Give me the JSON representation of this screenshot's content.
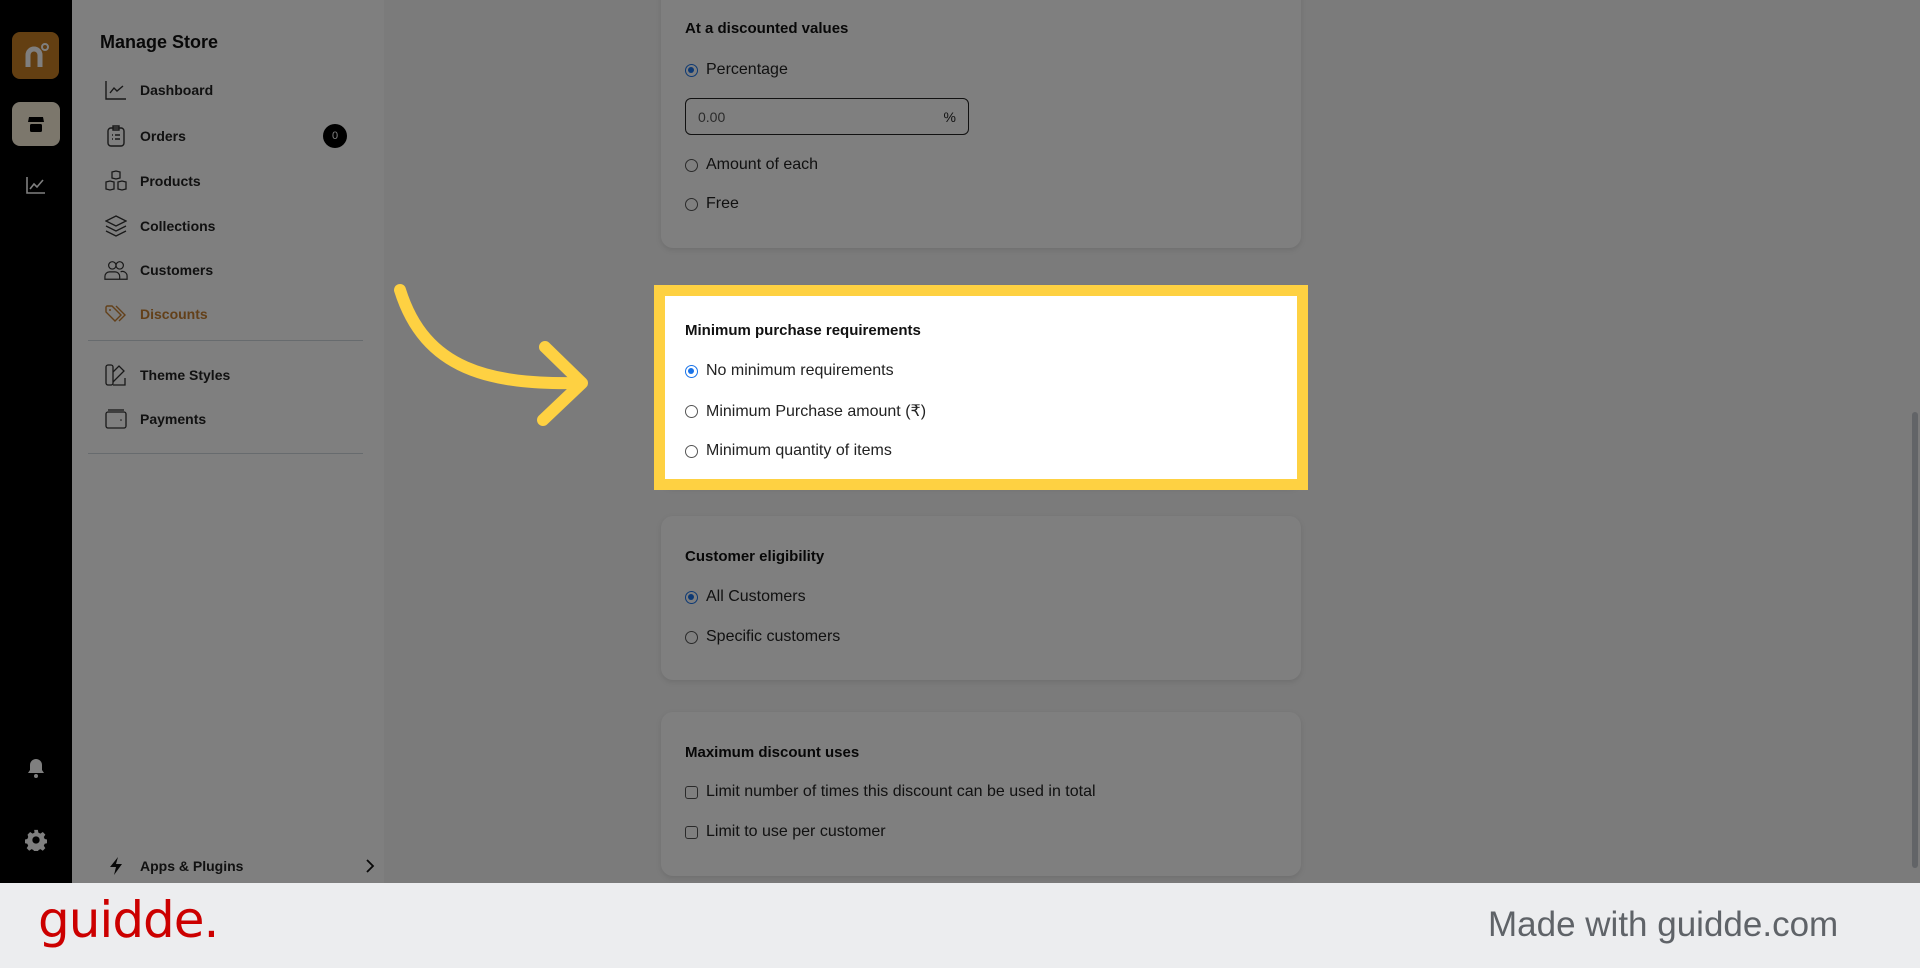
{
  "rail": {
    "logo_letter": "n",
    "icons": [
      "store-icon",
      "analytics-icon",
      "bell-icon",
      "gear-icon"
    ]
  },
  "sidebar": {
    "title": "Manage Store",
    "items": [
      {
        "label": "Dashboard",
        "icon": "line-chart-icon"
      },
      {
        "label": "Orders",
        "icon": "clipboard-icon",
        "badge": "0"
      },
      {
        "label": "Products",
        "icon": "boxes-icon"
      },
      {
        "label": "Collections",
        "icon": "layers-icon"
      },
      {
        "label": "Customers",
        "icon": "users-icon"
      },
      {
        "label": "Discounts",
        "icon": "tag-icon",
        "active": true
      }
    ],
    "secondary_items": [
      {
        "label": "Theme Styles",
        "icon": "swatch-icon"
      },
      {
        "label": "Payments",
        "icon": "wallet-icon"
      }
    ],
    "apps_plugins": {
      "label": "Apps & Plugins",
      "icon": "bolt-icon"
    },
    "accent_color": "#c68133"
  },
  "discount_value": {
    "title": "At a discounted values",
    "options": [
      {
        "label": "Percentage",
        "selected": true
      },
      {
        "label": "Amount of each",
        "selected": false
      },
      {
        "label": "Free",
        "selected": false
      }
    ],
    "percentage_input": {
      "value": "0.00",
      "suffix": "%"
    }
  },
  "minimum_purchase": {
    "title": "Minimum purchase requirements",
    "options": [
      {
        "label": "No minimum requirements",
        "selected": true
      },
      {
        "label": "Minimum Purchase amount (₹)",
        "selected": false
      },
      {
        "label": "Minimum quantity of items",
        "selected": false
      }
    ],
    "highlight_color": "#fed142"
  },
  "customer_eligibility": {
    "title": "Customer eligibility",
    "options": [
      {
        "label": "All Customers",
        "selected": true
      },
      {
        "label": "Specific customers",
        "selected": false
      }
    ]
  },
  "maximum_uses": {
    "title": "Maximum discount uses",
    "options": [
      {
        "label": "Limit number of times this discount can be used in total",
        "checked": false
      },
      {
        "label": "Limit to use per customer",
        "checked": false
      }
    ]
  },
  "footer": {
    "logo": "guidde.",
    "made_with": "Made with guidde.com",
    "logo_color": "#cc0000"
  }
}
